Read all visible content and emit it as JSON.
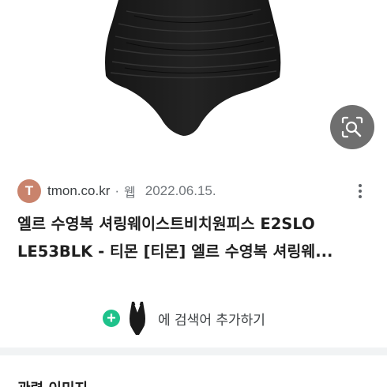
{
  "result": {
    "image": {
      "alt": "black shirred one-piece swimsuit"
    },
    "lens_icon": "image-search-icon",
    "source": {
      "favicon_letter": "T",
      "favicon_color": "#c9836c",
      "domain": "tmon.co.kr",
      "separator": "·",
      "type": "웹",
      "date": "2022.06.15."
    },
    "more_icon": "more-vert-icon",
    "title_lines": [
      "엘르 수영복 셔링웨이스트비치원피스 E2SLO",
      "LE53BLK - 티몬 [티몬] 엘르 수영복 셔링웨..."
    ],
    "add_to_search": {
      "plus_icon": "plus-icon",
      "plus_color": "#1ec28b",
      "label": "에 검색어 추가하기"
    }
  },
  "related_section": {
    "heading": "관련 이미지"
  }
}
